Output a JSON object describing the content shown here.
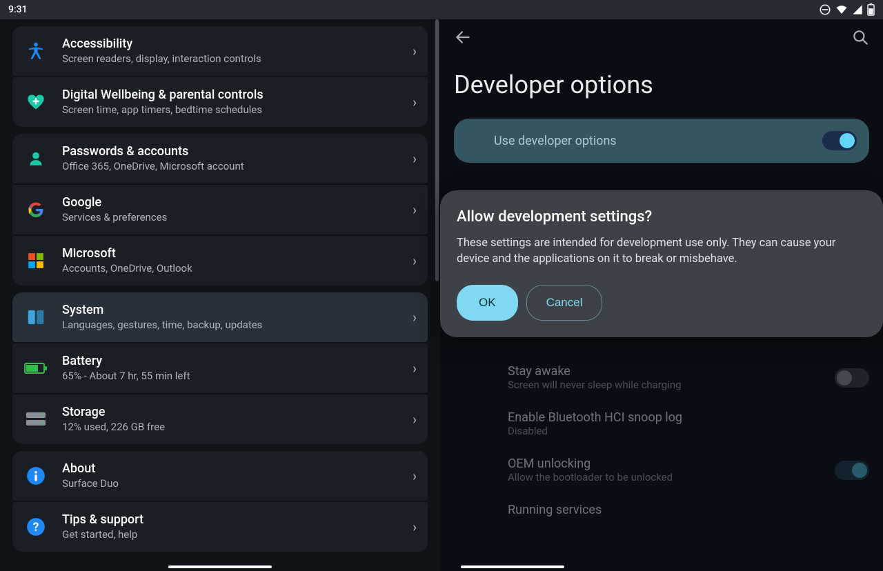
{
  "status": {
    "time": "9:31"
  },
  "left": {
    "groups": [
      {
        "items": [
          {
            "key": "accessibility",
            "title": "Accessibility",
            "sub": "Screen readers, display, interaction controls"
          },
          {
            "key": "wellbeing",
            "title": "Digital Wellbeing & parental controls",
            "sub": "Screen time, app timers, bedtime schedules"
          }
        ]
      },
      {
        "items": [
          {
            "key": "passwords",
            "title": "Passwords & accounts",
            "sub": "Office 365, OneDrive, Microsoft account"
          },
          {
            "key": "google",
            "title": "Google",
            "sub": "Services & preferences"
          },
          {
            "key": "microsoft",
            "title": "Microsoft",
            "sub": "Accounts, OneDrive, Outlook"
          }
        ]
      },
      {
        "items": [
          {
            "key": "system",
            "title": "System",
            "sub": "Languages, gestures, time, backup, updates",
            "selected": true
          },
          {
            "key": "battery",
            "title": "Battery",
            "sub": "65% - About 7 hr, 55 min left"
          },
          {
            "key": "storage",
            "title": "Storage",
            "sub": "12% used, 226 GB free"
          }
        ]
      },
      {
        "items": [
          {
            "key": "about",
            "title": "About",
            "sub": "Surface Duo"
          },
          {
            "key": "tips",
            "title": "Tips & support",
            "sub": "Get started, help"
          }
        ]
      }
    ]
  },
  "right": {
    "page_title": "Developer options",
    "master_toggle_label": "Use developer options",
    "dialog": {
      "title": "Allow development settings?",
      "body": "These settings are intended for development use only. They can cause your device and the applications on it to break or misbehave.",
      "ok": "OK",
      "cancel": "Cancel"
    },
    "bg_options": [
      {
        "key": "stay-awake",
        "title": "Stay awake",
        "sub": "Screen will never sleep while charging",
        "toggle": "off"
      },
      {
        "key": "hci",
        "title": "Enable Bluetooth HCI snoop log",
        "sub": "Disabled",
        "toggle": "none"
      },
      {
        "key": "oem",
        "title": "OEM unlocking",
        "sub": "Allow the bootloader to be unlocked",
        "toggle": "on"
      },
      {
        "key": "running",
        "title": "Running services",
        "sub": "",
        "toggle": "none"
      }
    ]
  },
  "icons": {
    "accessibility": {
      "svg": "accessibility",
      "color": "#1e88f5"
    },
    "wellbeing": {
      "svg": "heart",
      "color": "#1cc9a8"
    },
    "passwords": {
      "svg": "person",
      "color": "#1cc9a8"
    },
    "google": {
      "svg": "google",
      "color": ""
    },
    "microsoft": {
      "svg": "microsoft",
      "color": ""
    },
    "system": {
      "svg": "system",
      "color": "#3aa7e0"
    },
    "battery": {
      "svg": "battery",
      "color": "#2fbd4a"
    },
    "storage": {
      "svg": "storage",
      "color": "#8a9099"
    },
    "about": {
      "svg": "info",
      "color": "#1e88f5"
    },
    "tips": {
      "svg": "help",
      "color": "#1e88f5"
    }
  }
}
